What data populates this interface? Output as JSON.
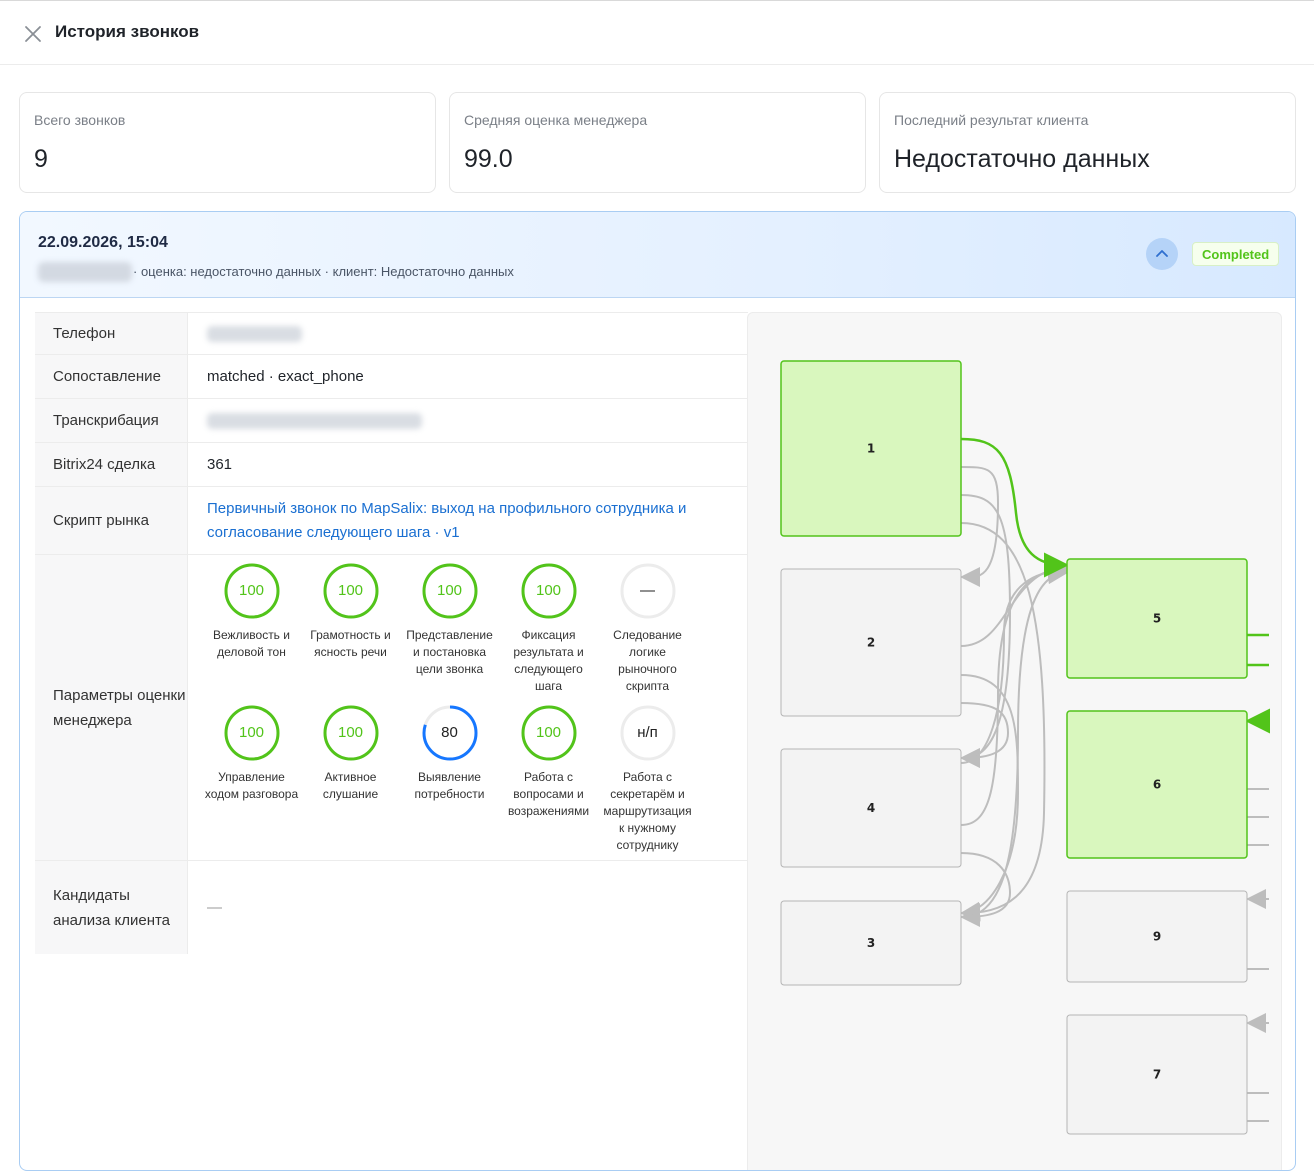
{
  "header": {
    "title": "История звонков",
    "close_icon": "close-icon"
  },
  "stats": [
    {
      "label": "Всего звонков",
      "value": "9"
    },
    {
      "label": "Средняя оценка менеджера",
      "value": "99.0"
    },
    {
      "label": "Последний результат клиента",
      "value": "Недостаточно данных"
    }
  ],
  "call": {
    "datetime": "22.09.2026, 15:04",
    "meta": "· оценка: недостаточно данных · клиент: Недостаточно данных",
    "status": "Completed",
    "collapse_icon": "chevron-up-icon",
    "colors": {
      "status": "#52c41a",
      "accent": "#1a6fd1",
      "ring_ok": "#52c41a",
      "ring_mid": "#1677ff"
    }
  },
  "details": {
    "phone_label": "Телефон",
    "matching_label": "Сопоставление",
    "matching_value": "matched · exact_phone",
    "transcription_label": "Транскрибация",
    "bitrix_label": "Bitrix24 сделка",
    "bitrix_value": "361",
    "script_label": "Скрипт рынка",
    "script_value": "Первичный звонок по MapSalix: выход на профильного сотрудника и согласование следующего шага · v1",
    "params_label": "Параметры оценки менеджера",
    "candidates_label": "Кандидаты анализа клиента",
    "candidates_value": "—"
  },
  "metrics": [
    {
      "label": "Вежливость и деловой тон",
      "score": "100",
      "level": 100
    },
    {
      "label": "Грамотность и ясность речи",
      "score": "100",
      "level": 100
    },
    {
      "label": "Представление и постановка цели звонка",
      "score": "100",
      "level": 100
    },
    {
      "label": "Фиксация результата и следующего шага",
      "score": "100",
      "level": 100
    },
    {
      "label": "Следование логике рыночного скрипта",
      "score": "—",
      "level": 0
    },
    {
      "label": "Управление ходом разговора",
      "score": "100",
      "level": 100
    },
    {
      "label": "Активное слушание",
      "score": "100",
      "level": 100
    },
    {
      "label": "Выявление потребности",
      "score": "80",
      "level": 80
    },
    {
      "label": "Работа с вопросами и возражениями",
      "score": "100",
      "level": 100
    },
    {
      "label": "Работа с секретарём и маршрутизация к нужному сотруднику",
      "score": "н/п",
      "level": 0
    }
  ],
  "flow_nodes": [
    {
      "id": "1",
      "label": "1",
      "active": true
    },
    {
      "id": "2",
      "label": "2",
      "active": false
    },
    {
      "id": "4",
      "label": "4",
      "active": false
    },
    {
      "id": "3",
      "label": "3",
      "active": false
    },
    {
      "id": "5",
      "label": "5",
      "active": true
    },
    {
      "id": "6",
      "label": "6",
      "active": true
    },
    {
      "id": "9",
      "label": "9",
      "active": false
    },
    {
      "id": "7",
      "label": "7",
      "active": false
    }
  ]
}
